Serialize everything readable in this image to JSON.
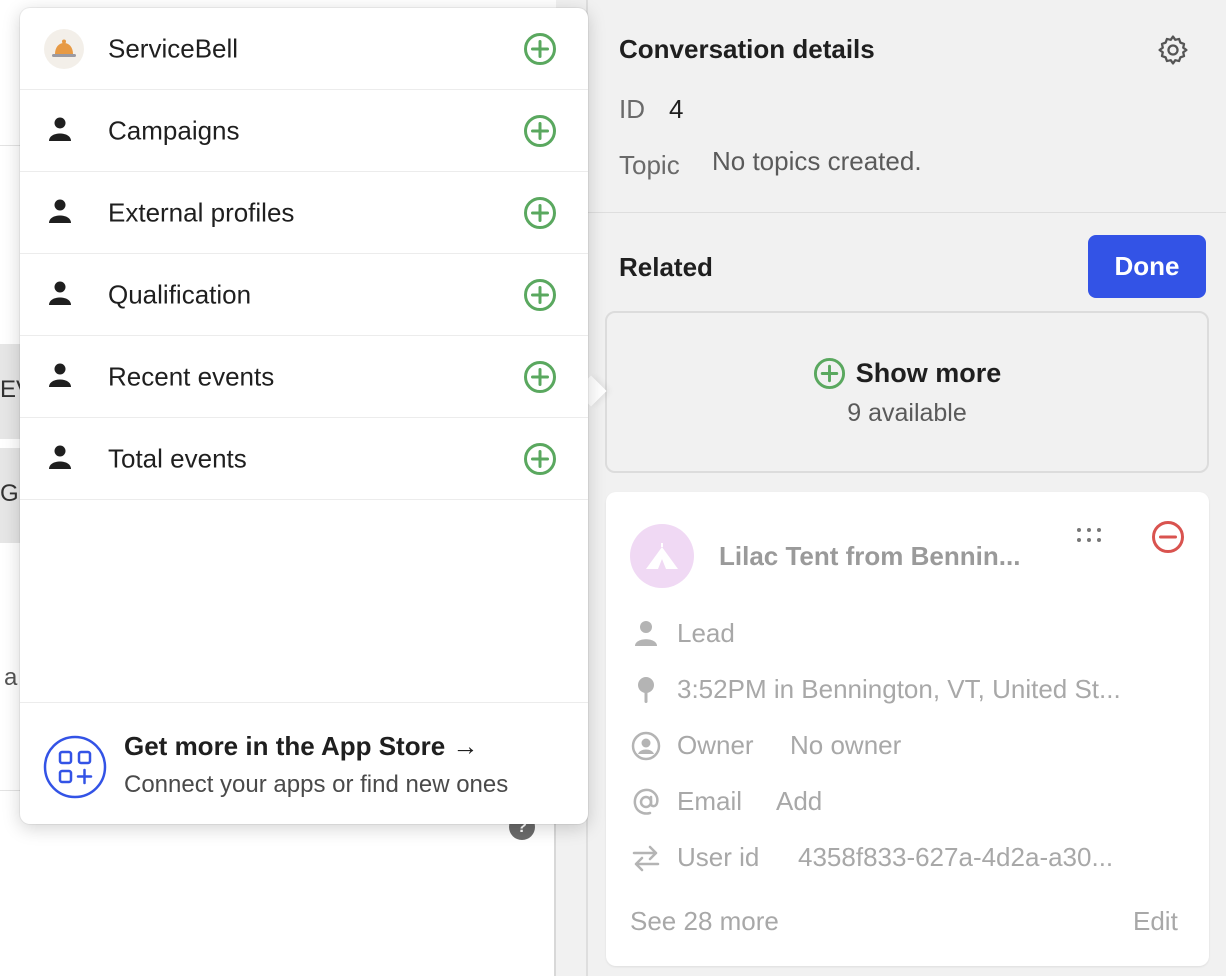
{
  "background": {
    "chip_1": "EV",
    "chip_2": "G",
    "partial_text": "a",
    "help": "?"
  },
  "popover": {
    "apps": [
      {
        "label": "ServiceBell",
        "icon": "bell-icon"
      },
      {
        "label": "Campaigns",
        "icon": "person-icon"
      },
      {
        "label": "External profiles",
        "icon": "person-icon"
      },
      {
        "label": "Qualification",
        "icon": "person-icon"
      },
      {
        "label": "Recent events",
        "icon": "person-icon"
      },
      {
        "label": "Total events",
        "icon": "person-icon"
      }
    ],
    "app_store": {
      "title": "Get more in the App Store →",
      "subtitle": "Connect your apps or find new ones"
    }
  },
  "details": {
    "title": "Conversation details",
    "id_label": "ID",
    "id_value": "4",
    "topic_label": "Topic",
    "topic_value": "No topics created."
  },
  "related": {
    "title": "Related",
    "done_label": "Done",
    "show_more_label": "Show more",
    "available_text": "9 available"
  },
  "company": {
    "name": "Lilac Tent from Bennin...",
    "role": "Lead",
    "location": "3:52PM in Bennington, VT, United St...",
    "owner_label": "Owner",
    "owner_value": "No owner",
    "email_label": "Email",
    "email_value": "Add",
    "userid_label": "User id",
    "userid_value": "4358f833-627a-4d2a-a30...",
    "see_more": "See 28 more",
    "edit_label": "Edit"
  },
  "colors": {
    "accent_blue": "#3353e6",
    "add_green": "#5aa85f",
    "remove_red": "#d9534f"
  }
}
